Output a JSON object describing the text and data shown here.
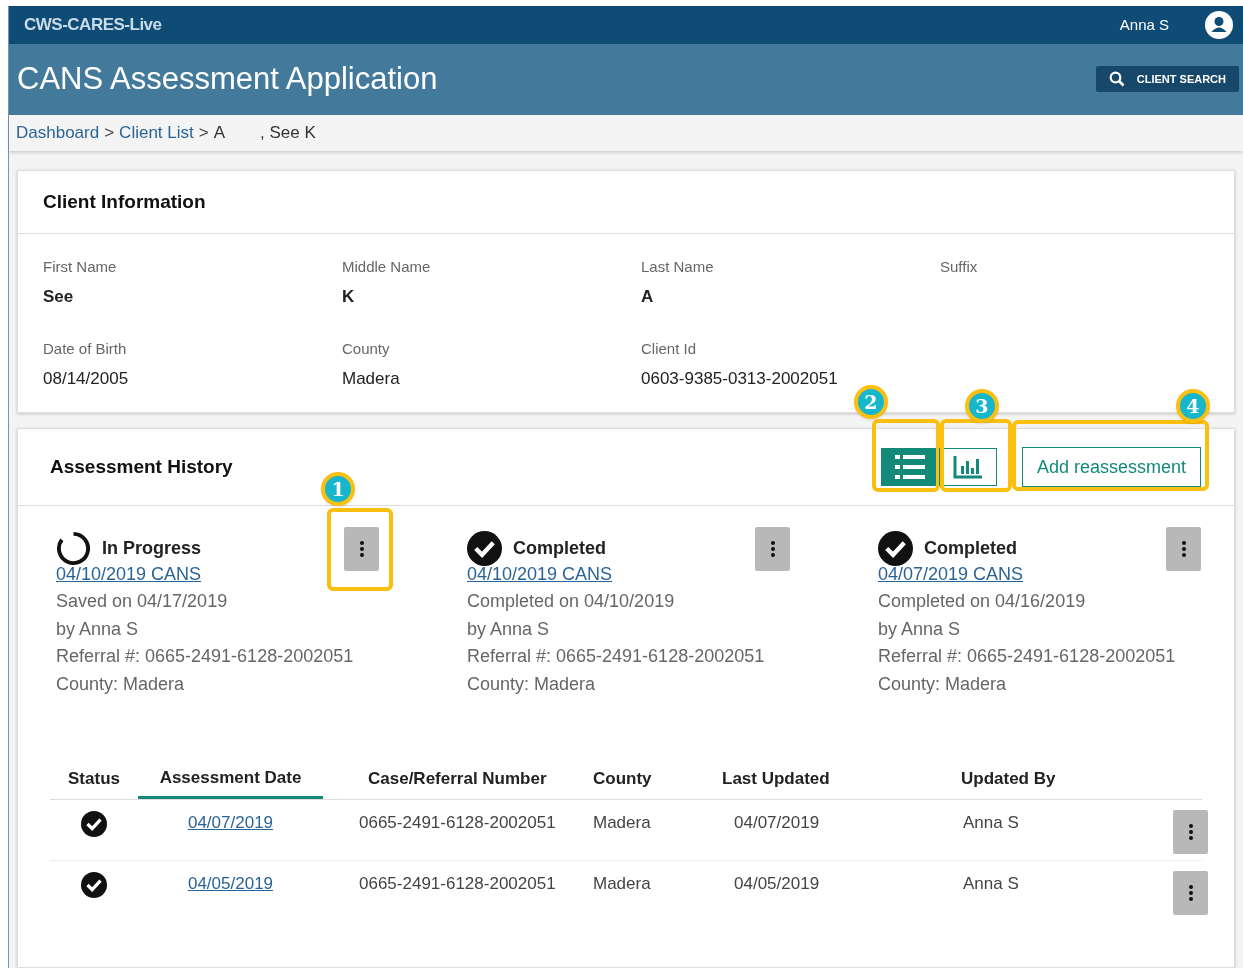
{
  "top_bar": {
    "app_name": "CWS-CARES-Live",
    "user": "Anna S"
  },
  "header": {
    "title": "CANS Assessment Application",
    "search_button": "CLIENT SEARCH"
  },
  "breadcrumb": {
    "separator": ">",
    "items": [
      {
        "label": "Dashboard",
        "kind": "link"
      },
      {
        "label": "Client List",
        "kind": "link"
      },
      {
        "label": "A",
        "kind": "text"
      },
      {
        "label": ", See K",
        "kind": "text"
      }
    ]
  },
  "client_info": {
    "title": "Client Information",
    "fields": [
      {
        "label": "First Name",
        "value": "See"
      },
      {
        "label": "Middle Name",
        "value": "K"
      },
      {
        "label": "Last Name",
        "value": "A"
      },
      {
        "label": "Suffix"
      },
      {
        "label": "Date of Birth",
        "value": "08/14/2005"
      },
      {
        "label": "County",
        "value": "Madera"
      },
      {
        "label": "Client Id",
        "value": "0603-9385-0313-2002051"
      }
    ]
  },
  "assessment_history": {
    "title": "Assessment History",
    "view_toggle": [
      {
        "kind": "list",
        "selected": true,
        "callout": "2"
      },
      {
        "kind": "chart",
        "selected": false,
        "callout": "3"
      }
    ],
    "add_button": {
      "label": "Add reassessment",
      "callout": "4"
    },
    "cards": [
      {
        "kind": "in_progress",
        "callout": "1",
        "status": "In Progress",
        "link": "04/10/2019 CANS",
        "lines": [
          "Saved on 04/17/2019",
          "by Anna S",
          "Referral #: 0665-2491-6128-2002051",
          "County: Madera"
        ]
      },
      {
        "kind": "completed",
        "status": "Completed",
        "link": "04/10/2019 CANS",
        "lines": [
          "Completed on 04/10/2019",
          "by Anna S",
          "Referral #: 0665-2491-6128-2002051",
          "County: Madera"
        ]
      },
      {
        "kind": "completed",
        "status": "Completed",
        "link": "04/07/2019 CANS",
        "lines": [
          "Completed on 04/16/2019",
          "by Anna S",
          "Referral #: 0665-2491-6128-2002051",
          "County: Madera"
        ]
      }
    ],
    "table": {
      "columns": [
        {
          "label": "Status",
          "selected": false
        },
        {
          "label": "Assessment Date",
          "selected": true
        },
        {
          "label": "Case/Referral Number",
          "selected": false
        },
        {
          "label": "County",
          "selected": false
        },
        {
          "label": "Last Updated",
          "selected": false
        },
        {
          "label": "Updated By",
          "selected": false
        }
      ],
      "rows": [
        {
          "kind": "completed",
          "date": "04/07/2019",
          "case_number": "0665-2491-6128-2002051",
          "county": "Madera",
          "last_updated": "04/07/2019",
          "updated_by": "Anna S"
        },
        {
          "kind": "completed",
          "date": "04/05/2019",
          "case_number": "0665-2491-6128-2002051",
          "county": "Madera",
          "last_updated": "04/05/2019",
          "updated_by": "Anna S"
        }
      ]
    }
  }
}
